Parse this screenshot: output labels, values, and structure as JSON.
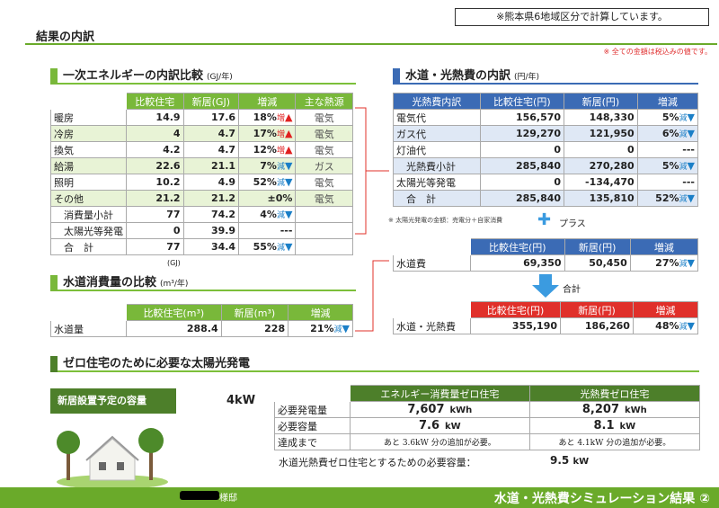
{
  "header": {
    "note": "※熊本県6地域区分で計算しています。",
    "page_title": "結果の内訳",
    "tax_note": "※ 全ての金額は税込みの値です。"
  },
  "energy": {
    "title": "一次エネルギーの内訳比較",
    "unit": "(GJ/年)",
    "columns": [
      "比較住宅",
      "新居(GJ)",
      "増減",
      "主な熱源"
    ],
    "rows": [
      {
        "label": "暖房",
        "compare": "14.9",
        "new": "17.6",
        "diff": "18%",
        "mark": "増",
        "dir": "up",
        "source": "電気"
      },
      {
        "label": "冷房",
        "compare": "4",
        "new": "4.7",
        "diff": "17%",
        "mark": "増",
        "dir": "up",
        "source": "電気"
      },
      {
        "label": "換気",
        "compare": "4.2",
        "new": "4.7",
        "diff": "12%",
        "mark": "増",
        "dir": "up",
        "source": "電気"
      },
      {
        "label": "給湯",
        "compare": "22.6",
        "new": "21.1",
        "diff": "7%",
        "mark": "減",
        "dir": "down",
        "source": "ガス"
      },
      {
        "label": "照明",
        "compare": "10.2",
        "new": "4.9",
        "diff": "52%",
        "mark": "減",
        "dir": "down",
        "source": "電気"
      },
      {
        "label": "その他",
        "compare": "21.2",
        "new": "21.2",
        "diff": "±0%",
        "mark": "",
        "dir": "",
        "source": "電気"
      },
      {
        "label": "消費量小計",
        "compare": "77",
        "new": "74.2",
        "diff": "4%",
        "mark": "減",
        "dir": "down",
        "source": ""
      },
      {
        "label": "太陽光等発電",
        "compare": "0",
        "new": "39.9",
        "diff": "---",
        "mark": "",
        "dir": "",
        "source": ""
      },
      {
        "label": "合　計",
        "compare": "77",
        "new": "34.4",
        "diff": "55%",
        "mark": "減",
        "dir": "down",
        "source": ""
      }
    ],
    "footnote_unit": "(GJ)"
  },
  "water": {
    "title": "水道消費量の比較",
    "unit": "(m³/年)",
    "columns": [
      "比較住宅(m³)",
      "新居(m³)",
      "増減"
    ],
    "row": {
      "label": "水道量",
      "compare": "288.4",
      "new": "228",
      "diff": "21%",
      "mark": "減"
    }
  },
  "cost": {
    "title": "水道・光熱費の内訳",
    "unit": "(円/年)",
    "columns": [
      "光熱費内訳",
      "比較住宅(円)",
      "新居(円)",
      "増減"
    ],
    "rows": [
      {
        "label": "電気代",
        "compare": "156,570",
        "new": "148,330",
        "diff": "5%",
        "mark": "減"
      },
      {
        "label": "ガス代",
        "compare": "129,270",
        "new": "121,950",
        "diff": "6%",
        "mark": "減"
      },
      {
        "label": "灯油代",
        "compare": "0",
        "new": "0",
        "diff": "---",
        "mark": ""
      },
      {
        "label": "光熱費小計",
        "compare": "285,840",
        "new": "270,280",
        "diff": "5%",
        "mark": "減"
      },
      {
        "label": "太陽光等発電",
        "compare": "0",
        "new": "-134,470",
        "diff": "---",
        "mark": ""
      },
      {
        "label": "合　計",
        "compare": "285,840",
        "new": "135,810",
        "diff": "52%",
        "mark": "減"
      }
    ],
    "solar_note": "※ 太陽光発電の金額：売電分＋自家消費",
    "plus_label": "プラス",
    "water_columns": [
      "",
      "比較住宅(円)",
      "新居(円)",
      "増減"
    ],
    "water_row": {
      "label": "水道費",
      "compare": "69,350",
      "new": "50,450",
      "diff": "27%",
      "mark": "減"
    },
    "sum_label": "合計",
    "total_row": {
      "label": "水道・光熱費",
      "compare": "355,190",
      "new": "186,260",
      "diff": "48%",
      "mark": "減"
    }
  },
  "zero": {
    "title": "ゼロ住宅のために必要な太陽光発電",
    "capacity_label": "新居設置予定の容量",
    "capacity_value": "4kW",
    "columns": [
      "",
      "エネルギー消費量ゼロ住宅",
      "光熱費ゼロ住宅"
    ],
    "rows": [
      {
        "label": "必要発電量",
        "a": "7,607",
        "a_unit": "kWh",
        "b": "8,207",
        "b_unit": "kWh"
      },
      {
        "label": "必要容量",
        "a": "7.6",
        "a_unit": "kW",
        "b": "8.1",
        "b_unit": "kW"
      },
      {
        "label": "達成まで",
        "a": "あと 3.6kW 分の追加が必要。",
        "a_unit": "",
        "b": "あと 4.1kW 分の追加が必要。",
        "b_unit": ""
      }
    ],
    "water_zero_label": "水道光熱費ゼロ住宅とするための必要容量：",
    "water_zero_value": "9.5",
    "water_zero_unit": "kW"
  },
  "footer": {
    "owner": "様邸",
    "title": "水道・光熱費シミュレーション結果 ②"
  },
  "colors": {
    "green": "#79b83a",
    "blue": "#3b6bb5",
    "red": "#e0302a",
    "up": "#e02020",
    "down": "#1b7fc7"
  }
}
